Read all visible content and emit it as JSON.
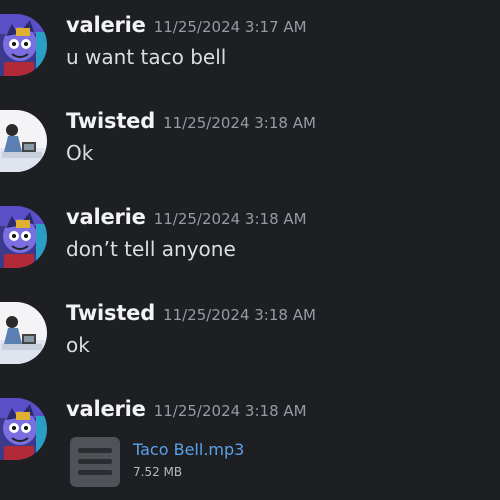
{
  "messages": [
    {
      "author": "valerie",
      "timestamp": "11/25/2024 3:17 AM",
      "text": "u want taco bell",
      "avatar": "valerie-avatar"
    },
    {
      "author": "Twisted",
      "timestamp": "11/25/2024 3:18 AM",
      "text": "Ok",
      "avatar": "twisted-avatar"
    },
    {
      "author": "valerie",
      "timestamp": "11/25/2024 3:18 AM",
      "text": "don’t tell anyone",
      "avatar": "valerie-avatar"
    },
    {
      "author": "Twisted",
      "timestamp": "11/25/2024 3:18 AM",
      "text": "ok",
      "avatar": "twisted-avatar"
    },
    {
      "author": "valerie",
      "timestamp": "11/25/2024 3:18 AM",
      "avatar": "valerie-avatar",
      "attachment": {
        "filename": "Taco Bell.mp3",
        "size": "7.52 MB",
        "icon": "file-icon"
      }
    }
  ],
  "colors": {
    "background": "#1e1f22",
    "author": "#f2f3f5",
    "timestamp": "#949ba4",
    "message_text": "#dbdee1",
    "link": "#5aa2ea"
  }
}
